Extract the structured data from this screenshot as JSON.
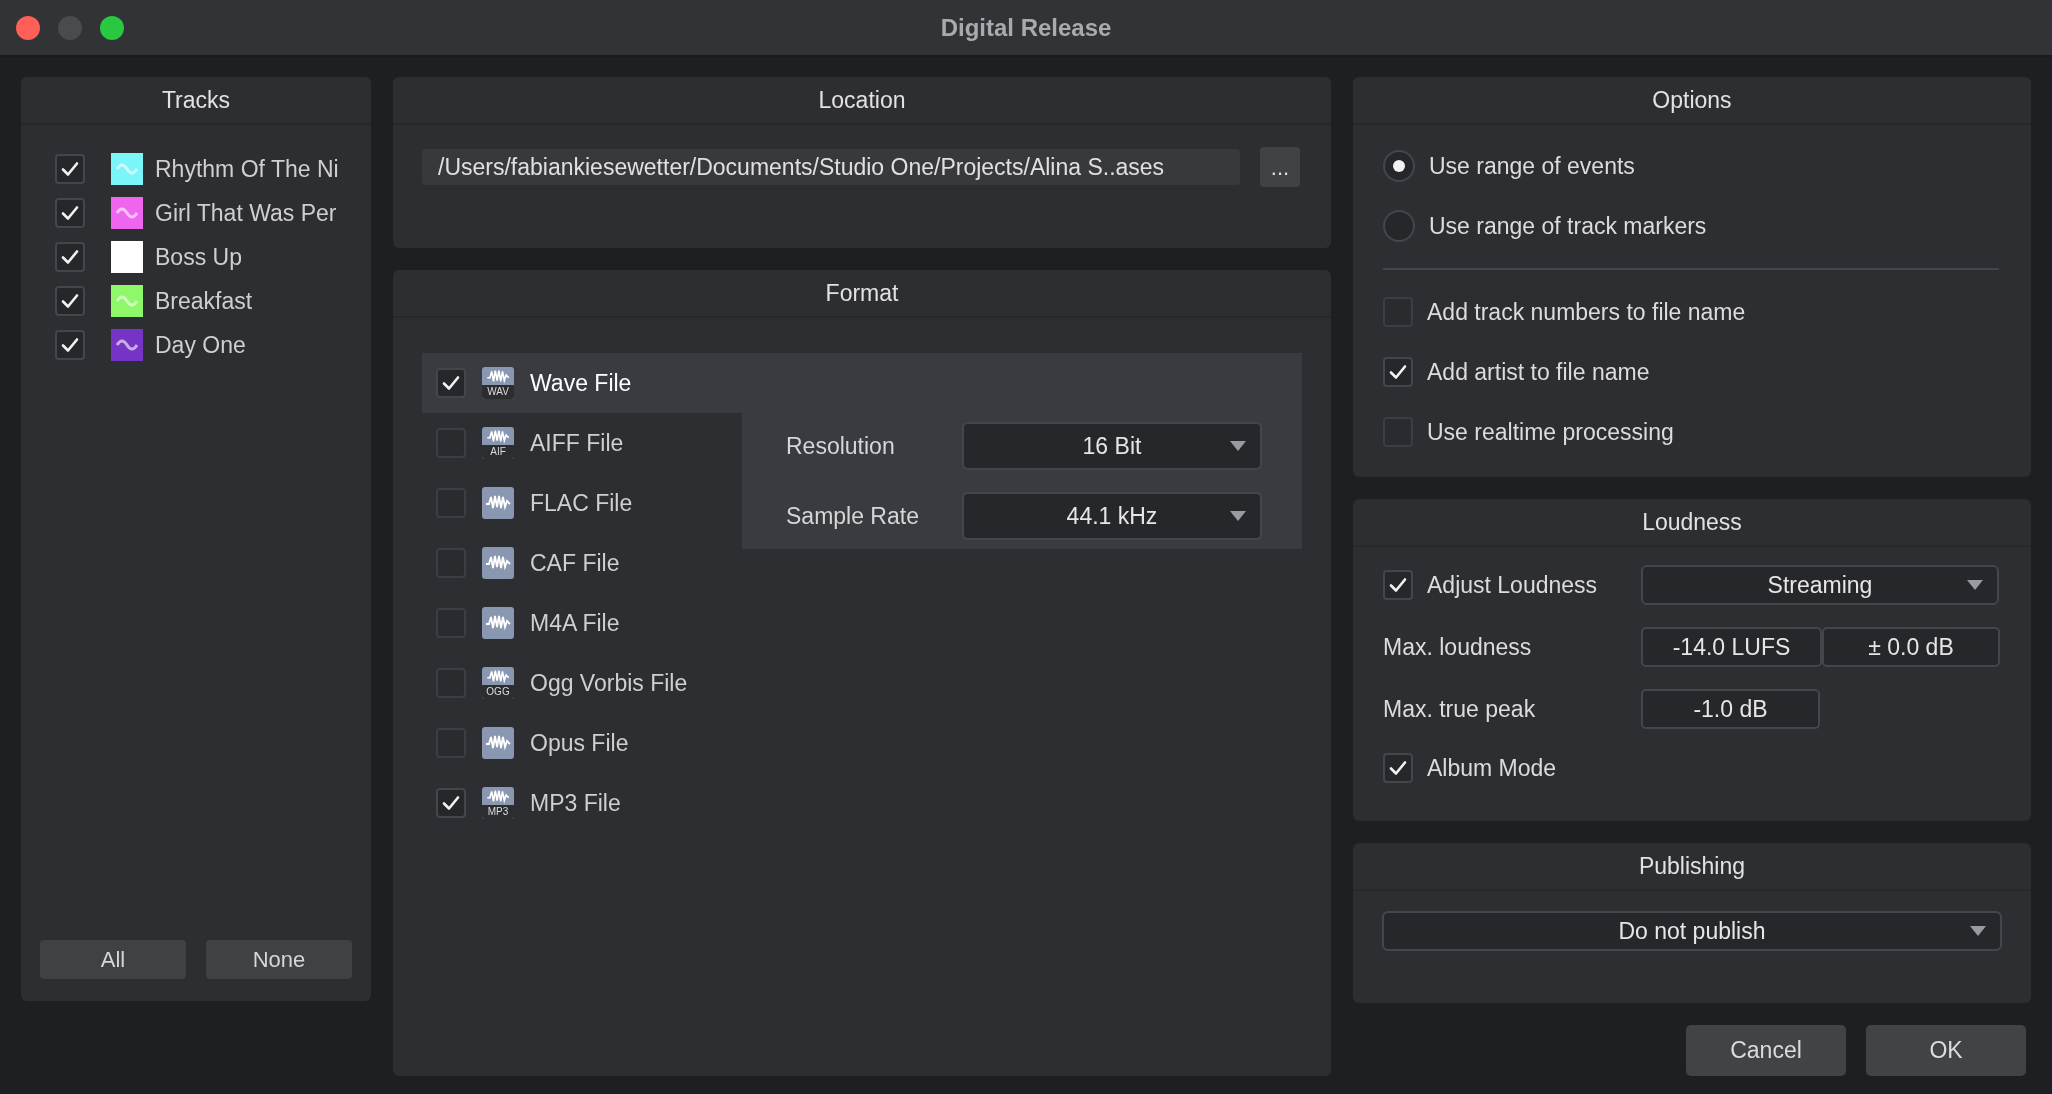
{
  "window": {
    "title": "Digital Release"
  },
  "tracks": {
    "title": "Tracks",
    "items": [
      {
        "name": "Rhythm Of The Ni",
        "checked": true,
        "color": "#7af6fb"
      },
      {
        "name": "Girl That Was Per",
        "checked": true,
        "color": "#ee66f0"
      },
      {
        "name": "Boss Up",
        "checked": true,
        "color": "#ffffff"
      },
      {
        "name": "Breakfast",
        "checked": true,
        "color": "#8ef86a"
      },
      {
        "name": "Day One",
        "checked": true,
        "color": "#7534c5"
      }
    ],
    "buttons": [
      "All",
      "None"
    ]
  },
  "location": {
    "title": "Location",
    "path": "/Users/fabiankiesewetter/Documents/Studio One/Projects/Alina S..ases",
    "browse_button": "..."
  },
  "format": {
    "title": "Format",
    "items": [
      {
        "name": "Wave File",
        "tag": "WAV",
        "checked": true,
        "selected": true
      },
      {
        "name": "AIFF File",
        "tag": "AIF",
        "checked": false,
        "selected": false
      },
      {
        "name": "FLAC File",
        "checked": false,
        "selected": false
      },
      {
        "name": "CAF File",
        "checked": false,
        "selected": false
      },
      {
        "name": "M4A File",
        "checked": false,
        "selected": false
      },
      {
        "name": "Ogg Vorbis File",
        "tag": "OGG",
        "checked": false,
        "selected": false
      },
      {
        "name": "Opus File",
        "checked": false,
        "selected": false
      },
      {
        "name": "MP3 File",
        "tag": "MP3",
        "checked": true,
        "selected": false
      }
    ],
    "settings": [
      {
        "label": "Resolution",
        "value": "16 Bit"
      },
      {
        "label": "Sample Rate",
        "value": "44.1 kHz"
      }
    ]
  },
  "options": {
    "title": "Options",
    "range_options": [
      {
        "label": "Use range of events",
        "selected": true
      },
      {
        "label": "Use range of track markers",
        "selected": false
      }
    ],
    "checkboxes": [
      {
        "label": "Add track numbers to file name",
        "checked": false
      },
      {
        "label": "Add artist to file name",
        "checked": true
      },
      {
        "label": "Use realtime processing",
        "checked": false
      }
    ]
  },
  "loudness": {
    "title": "Loudness",
    "adjust": {
      "label": "Adjust Loudness",
      "checked": true,
      "value": "Streaming"
    },
    "max_loudness": {
      "label": "Max. loudness",
      "value": "-14.0 LUFS",
      "offset": "± 0.0 dB"
    },
    "max_true_peak": {
      "label": "Max. true peak",
      "value": "-1.0 dB"
    },
    "album_mode": {
      "label": "Album Mode",
      "checked": true
    }
  },
  "publishing": {
    "title": "Publishing",
    "value": "Do not publish"
  },
  "buttons": [
    "Cancel",
    "OK"
  ]
}
